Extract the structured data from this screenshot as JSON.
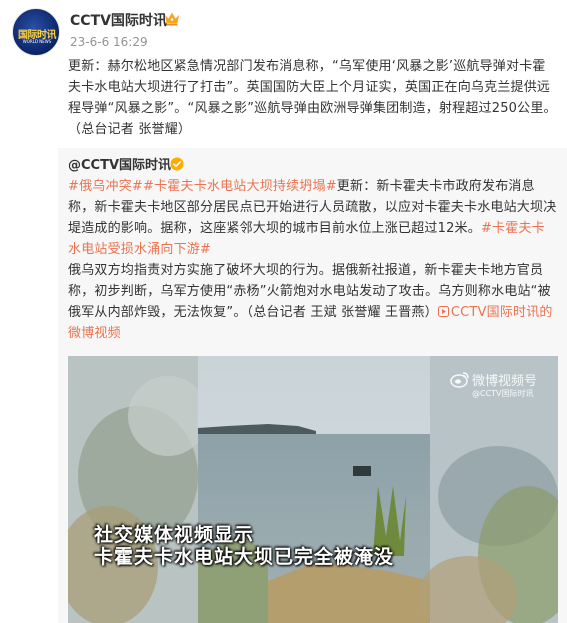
{
  "post": {
    "author": "CCTV国际时讯",
    "avatar_logo": "国际时讯",
    "avatar_sub": "WORLD NEWS",
    "time": "23-6-6 16:29",
    "body": "更新：赫尔松地区紧急情况部门发布消息称，“乌军使用‘风暴之影’巡航导弹对卡霍夫卡水电站大坝进行了打击”。英国国防大臣上个月证实，英国正在向乌克兰提供远程导弹“风暴之影”。“风暴之影”巡航导弹由欧洲导弹集团制造，射程超过250公里。（总台记者 张誉耀）"
  },
  "repost": {
    "author": "@CCTV国际时讯",
    "tag1": "#俄乌冲突#",
    "tag2": "#卡霍夫卡水电站大坝持续坍塌#",
    "text1": "更新：新卡霍夫卡市政府发布消息称，新卡霍夫卡地区部分居民点已开始进行人员疏散，以应对卡霍夫卡水电站大坝决堤造成的影响。据称，这座紧邻大坝的城市目前水位上涨已超过12米。",
    "tag3": "#卡霍夫卡水电站受损水涌向下游#",
    "text2": "俄乌双方均指责对方实施了破坏大坝的行为。据俄新社报道，新卡霍夫卡地方官员称，初步判断，乌军方使用“赤杨”火箭炮对水电站发动了攻击。乌方则称水电站“被俄军从内部炸毁，无法恢复”。（总台记者 王斌 张誉耀 王晋燕）",
    "link_text": "CCTV国际时讯的微博视频"
  },
  "video": {
    "watermark_title": "微博视频号",
    "watermark_sub": "@CCTV国际时讯",
    "caption_line1": "社交媒体视频显示",
    "caption_line2": "卡霍夫卡水电站大坝已完全被淹没"
  },
  "colors": {
    "tag": "#eb7350",
    "verified": "#ffab00",
    "crown": "#f6a623"
  }
}
